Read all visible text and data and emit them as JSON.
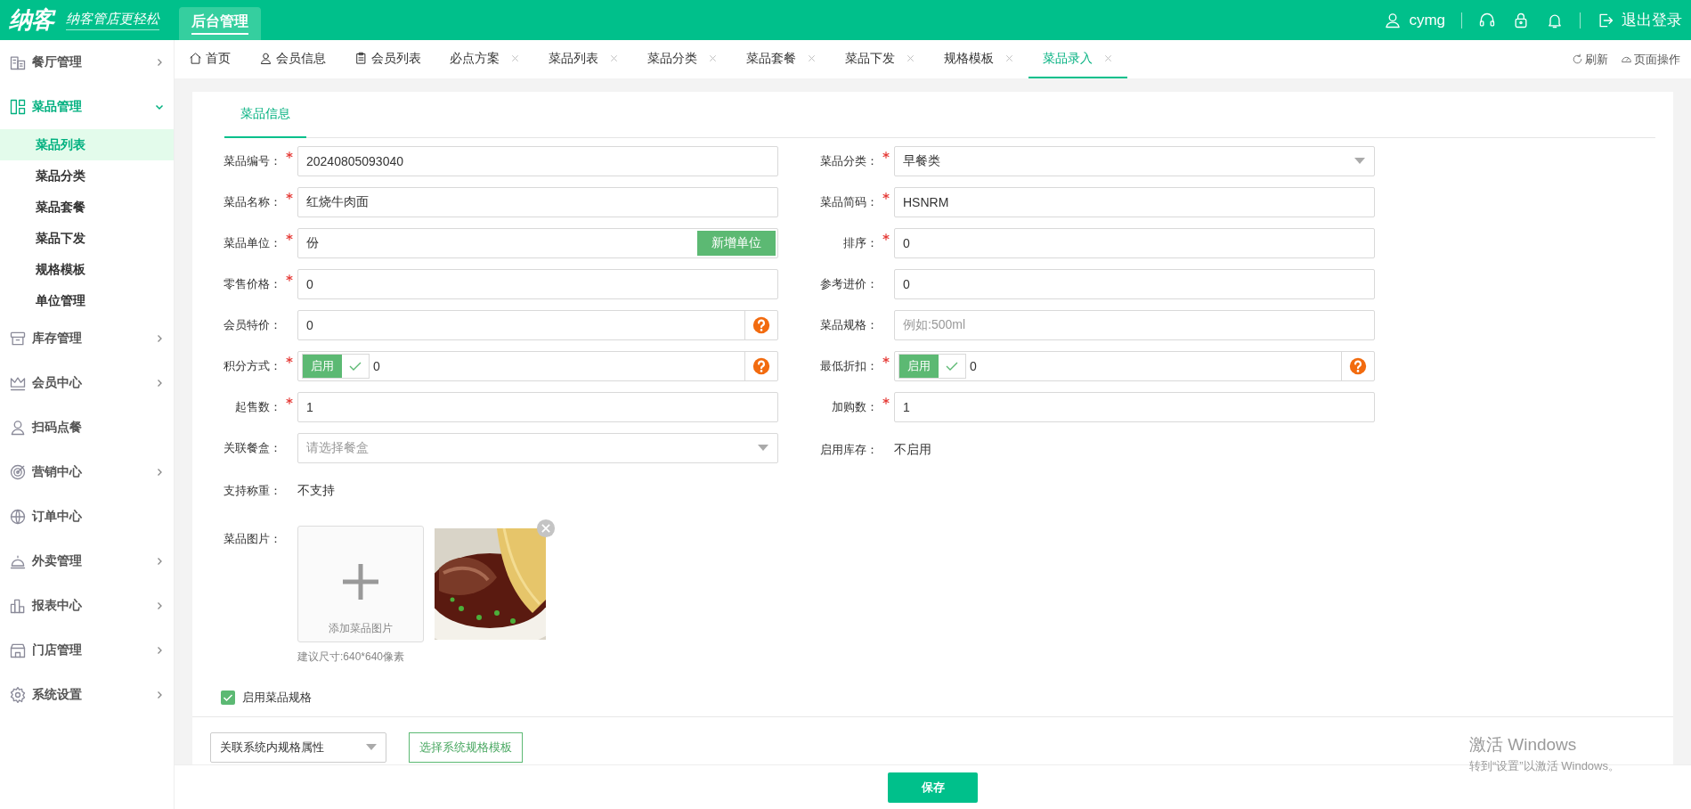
{
  "header": {
    "logo": "纳客",
    "slogan": "纳客管店更轻松",
    "module_tab": {
      "label": "后台管理",
      "selected": true
    },
    "user": "cymg",
    "logout": "退出登录"
  },
  "sidebar": {
    "items": [
      {
        "label": "餐厅管理",
        "expandable": true,
        "expanded": false
      },
      {
        "label": "菜品管理",
        "expandable": true,
        "expanded": true,
        "children": [
          {
            "label": "菜品列表",
            "selected": true
          },
          {
            "label": "菜品分类",
            "selected": false
          },
          {
            "label": "菜品套餐",
            "selected": false
          },
          {
            "label": "菜品下发",
            "selected": false
          },
          {
            "label": "规格模板",
            "selected": false
          },
          {
            "label": "单位管理",
            "selected": false
          }
        ]
      },
      {
        "label": "库存管理",
        "expandable": true,
        "expanded": false
      },
      {
        "label": "会员中心",
        "expandable": true,
        "expanded": false
      },
      {
        "label": "扫码点餐",
        "expandable": false,
        "expanded": false
      },
      {
        "label": "营销中心",
        "expandable": true,
        "expanded": false
      },
      {
        "label": "订单中心",
        "expandable": false,
        "expanded": false
      },
      {
        "label": "外卖管理",
        "expandable": true,
        "expanded": false
      },
      {
        "label": "报表中心",
        "expandable": true,
        "expanded": false
      },
      {
        "label": "门店管理",
        "expandable": true,
        "expanded": false
      },
      {
        "label": "系统设置",
        "expandable": true,
        "expanded": false
      }
    ]
  },
  "tabs": [
    {
      "label": "首页",
      "closable": false,
      "selected": false
    },
    {
      "label": "会员信息",
      "closable": false,
      "selected": false
    },
    {
      "label": "会员列表",
      "closable": false,
      "selected": false
    },
    {
      "label": "必点方案",
      "closable": true,
      "selected": false
    },
    {
      "label": "菜品列表",
      "closable": true,
      "selected": false
    },
    {
      "label": "菜品分类",
      "closable": true,
      "selected": false
    },
    {
      "label": "菜品套餐",
      "closable": true,
      "selected": false
    },
    {
      "label": "菜品下发",
      "closable": true,
      "selected": false
    },
    {
      "label": "规格模板",
      "closable": true,
      "selected": false
    },
    {
      "label": "菜品录入",
      "closable": true,
      "selected": true
    }
  ],
  "tab_actions": [
    "刷新",
    "页面操作"
  ],
  "form": {
    "section_tab": {
      "label": "菜品信息",
      "selected": true
    },
    "left_fields": [
      {
        "kind": "text",
        "label": "菜品编号：",
        "required": true,
        "value": "20240805093040"
      },
      {
        "kind": "text",
        "label": "菜品名称：",
        "required": true,
        "value": "红烧牛肉面"
      },
      {
        "kind": "text_button",
        "label": "菜品单位：",
        "required": true,
        "value": "份",
        "button": "新增单位"
      },
      {
        "kind": "text",
        "label": "零售价格：",
        "required": true,
        "value": "0"
      },
      {
        "kind": "text_help",
        "label": "会员特价：",
        "required": false,
        "value": "0"
      },
      {
        "kind": "toggle_help",
        "label": "积分方式：",
        "required": true,
        "toggle_label": "启用",
        "enabled": true,
        "value": "0"
      },
      {
        "kind": "text",
        "label": "起售数：",
        "required": true,
        "value": "1"
      },
      {
        "kind": "select",
        "label": "关联餐盒：",
        "required": false,
        "placeholder": "请选择餐盒"
      },
      {
        "kind": "static",
        "label": "支持称重：",
        "required": false,
        "value": "不支持"
      }
    ],
    "right_fields": [
      {
        "kind": "select",
        "label": "菜品分类：",
        "required": true,
        "value": "早餐类"
      },
      {
        "kind": "text",
        "label": "菜品简码：",
        "required": true,
        "value": "HSNRM"
      },
      {
        "kind": "text",
        "label": "排序：",
        "required": true,
        "value": "0"
      },
      {
        "kind": "text",
        "label": "参考进价：",
        "required": false,
        "value": "0"
      },
      {
        "kind": "text",
        "label": "菜品规格：",
        "required": false,
        "placeholder": "例如:500ml"
      },
      {
        "kind": "toggle_help",
        "label": "最低折扣：",
        "required": true,
        "toggle_label": "启用",
        "enabled": true,
        "value": "0"
      },
      {
        "kind": "text",
        "label": "加购数：",
        "required": true,
        "value": "1"
      },
      {
        "kind": "static",
        "label": "启用库存：",
        "required": false,
        "value": "不启用"
      }
    ],
    "image_field": {
      "label": "菜品图片：",
      "add_label": "添加菜品图片",
      "hint": "建议尺寸:640*640像素"
    },
    "spec_toggle": {
      "label": "启用菜品规格",
      "checked": true
    },
    "spec_select": {
      "value": "关联系统内规格属性"
    },
    "spec_button": "选择系统规格模板"
  },
  "save_button": "保存",
  "os_notice": {
    "title": "激活 Windows",
    "text": "转到“设置”以激活 Windows。"
  }
}
